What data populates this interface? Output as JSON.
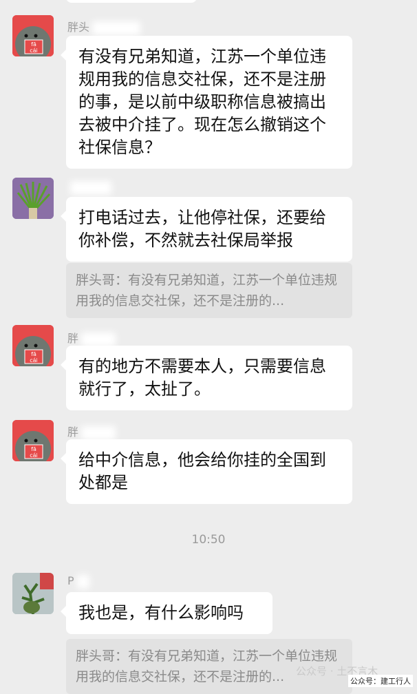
{
  "messages": [
    {
      "sender": "胖头",
      "text": "有没有兄弟知道，江苏一个单位违规用我的信息交社保，还不是注册的事，是以前中级职称信息被搞出去被中介挂了。现在怎么撤销这个社保信息？"
    },
    {
      "sender": "",
      "text": "打电话过去，让他停社保，还要给你补偿，不然就去社保局举报",
      "quote": "胖头哥：有没有兄弟知道，江苏一个单位违规用我的信息交社保，还不是注册的..."
    },
    {
      "sender": "胖",
      "text": "有的地方不需要本人，只需要信息就行了，太扯了。"
    },
    {
      "sender": "胖",
      "text": "给中介信息，他会给你挂的全国到处都是"
    },
    {
      "time": "10:50"
    },
    {
      "sender": "P",
      "text": "我也是，有什么影响吗",
      "quote": "胖头哥：有没有兄弟知道，江苏一个单位违规用我的信息交社保，还不是注册的..."
    }
  ],
  "avatar_glyphs": [
    "fā",
    "cái"
  ],
  "watermark": {
    "text1": "公众号 · 土不言木",
    "text2": "公众号：建工行人"
  },
  "colors": {
    "background": "#ededed",
    "bubble": "#ffffff",
    "quote": "#e2e2e2",
    "name": "#9a9a9a"
  }
}
